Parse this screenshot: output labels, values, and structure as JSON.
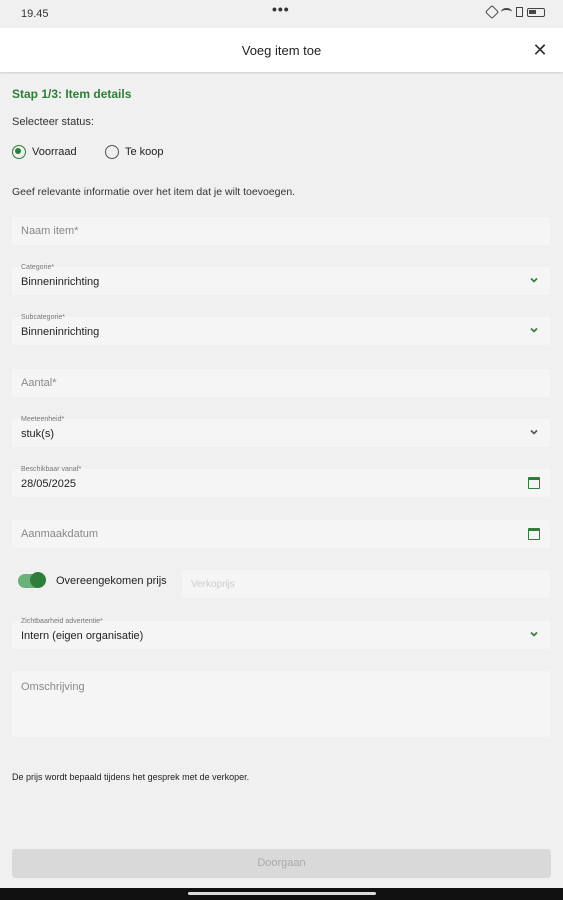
{
  "status_bar": {
    "time": "19.45",
    "dots": "•••"
  },
  "header": {
    "title": "Voeg item toe",
    "close_glyph": "✕"
  },
  "step": {
    "title": "Stap 1/3: Item details"
  },
  "status_select": {
    "label": "Selecteer status:",
    "options": [
      {
        "label": "Voorraad",
        "selected": true
      },
      {
        "label": "Te koop",
        "selected": false
      }
    ]
  },
  "info_text": "Geef relevante informatie over het item dat je wilt toevoegen.",
  "fields": {
    "name": {
      "placeholder": "Naam item*"
    },
    "category": {
      "label": "Categorie*",
      "value": "Binneninrichting"
    },
    "subcategory": {
      "label": "Subcategorie*",
      "value": "Binneninrichting"
    },
    "quantity": {
      "placeholder": "Aantal*"
    },
    "unit": {
      "label": "Meeteenheid*",
      "value": "stuk(s)"
    },
    "available_from": {
      "label": "Beschikbaar vanaf*",
      "value": "28/05/2025"
    },
    "creation_date": {
      "placeholder": "Aanmaakdatum"
    },
    "agreed_price": {
      "label": "Overeengekomen prijs",
      "enabled": true,
      "input_placeholder": "Verkoprijs"
    },
    "visibility": {
      "label": "Zichtbaarheid advertentie*",
      "value": "Intern (eigen organisatie)"
    },
    "description": {
      "placeholder": "Omschrijving"
    }
  },
  "note": "De prijs wordt bepaald tijdens het gesprek met de verkoper.",
  "footer": {
    "continue_label": "Doorgaan"
  },
  "colors": {
    "accent": "#2e7d3a",
    "background": "#f0f0f0",
    "field": "#f5f5f5"
  }
}
